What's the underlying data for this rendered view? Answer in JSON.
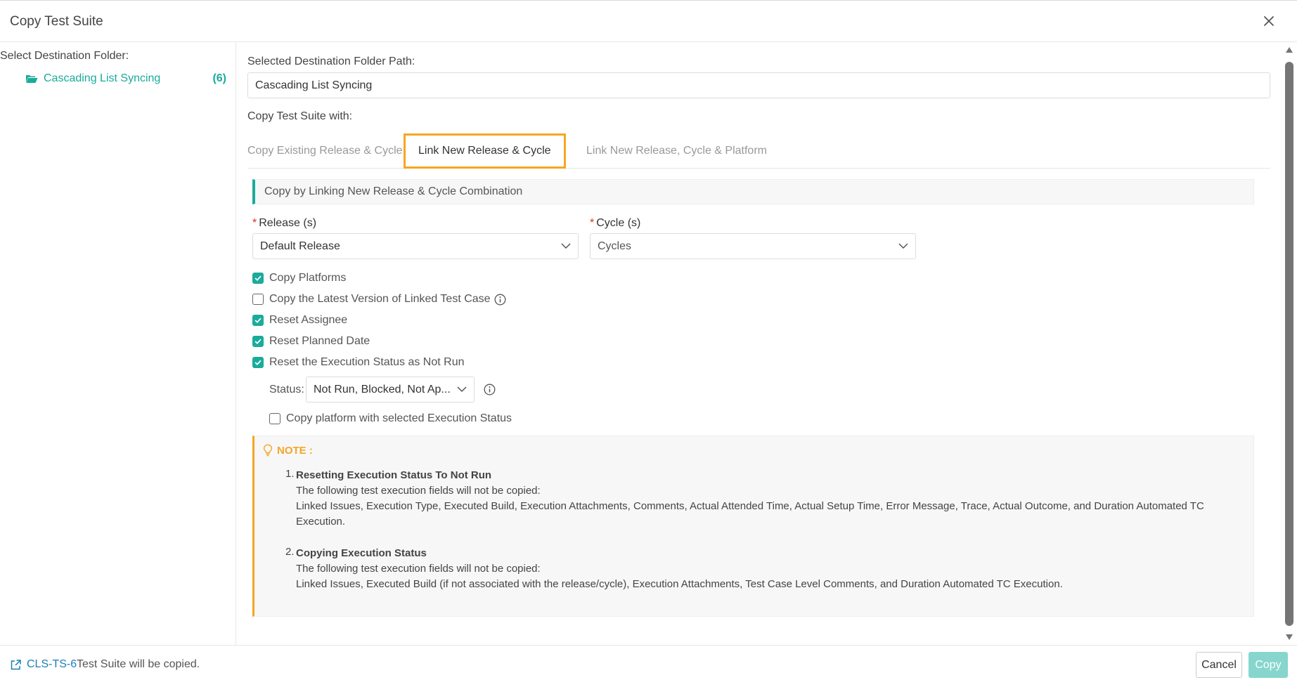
{
  "modal": {
    "title": "Copy Test Suite"
  },
  "left_pane": {
    "label": "Select Destination Folder:",
    "folder": {
      "label": "Cascading List Syncing",
      "count": "(6)"
    }
  },
  "main": {
    "path_label": "Selected Destination Folder Path:",
    "path_value": "Cascading List Syncing",
    "copy_with_label": "Copy Test Suite with:",
    "tabs": [
      {
        "label": "Copy Existing Release & Cycle",
        "active": false
      },
      {
        "label": "Link New Release & Cycle",
        "active": true
      },
      {
        "label": "Link New Release, Cycle & Platform",
        "active": false
      }
    ],
    "section_title": "Copy by Linking New Release & Cycle Combination",
    "release": {
      "required_mark": "*",
      "label": "Release (s)",
      "value": "Default Release"
    },
    "cycle": {
      "required_mark": "*",
      "label": "Cycle (s)",
      "placeholder": "Cycles"
    },
    "options": [
      {
        "label": "Copy Platforms",
        "checked": true
      },
      {
        "label": "Copy the Latest Version of Linked Test Case",
        "checked": false,
        "info": true
      },
      {
        "label": "Reset Assignee",
        "checked": true
      },
      {
        "label": "Reset Planned Date",
        "checked": true
      },
      {
        "label": "Reset the Execution Status as Not Run",
        "checked": true
      }
    ],
    "status": {
      "label": "Status:",
      "value": "Not Run, Blocked, Not Ap..."
    },
    "copy_platform_status": {
      "label": "Copy platform with selected Execution Status",
      "checked": false
    },
    "note": {
      "title": "NOTE :",
      "items": [
        {
          "num": "1.",
          "heading": "Resetting Execution Status To Not Run",
          "line1": "The following test execution fields will not be copied:",
          "line2": "Linked Issues, Execution Type, Executed Build, Execution Attachments, Comments, Actual Attended Time, Actual Setup Time, Error Message, Trace, Actual Outcome, and Duration Automated TC Execution."
        },
        {
          "num": "2.",
          "heading": "Copying Execution Status",
          "line1": "The following test execution fields will not be copied:",
          "line2": "Linked Issues, Executed Build (if not associated with the release/cycle), Execution Attachments, Test Case Level Comments, and Duration Automated TC Execution."
        }
      ]
    }
  },
  "footer": {
    "suite_id": "CLS-TS-6",
    "message": "Test Suite will be copied.",
    "cancel_label": "Cancel",
    "copy_label": "Copy"
  },
  "colors": {
    "accent": "#1aab9b",
    "tab_highlight": "#f5a623",
    "link": "#1a7fb8",
    "copy_button_disabled": "#86d6cd"
  }
}
